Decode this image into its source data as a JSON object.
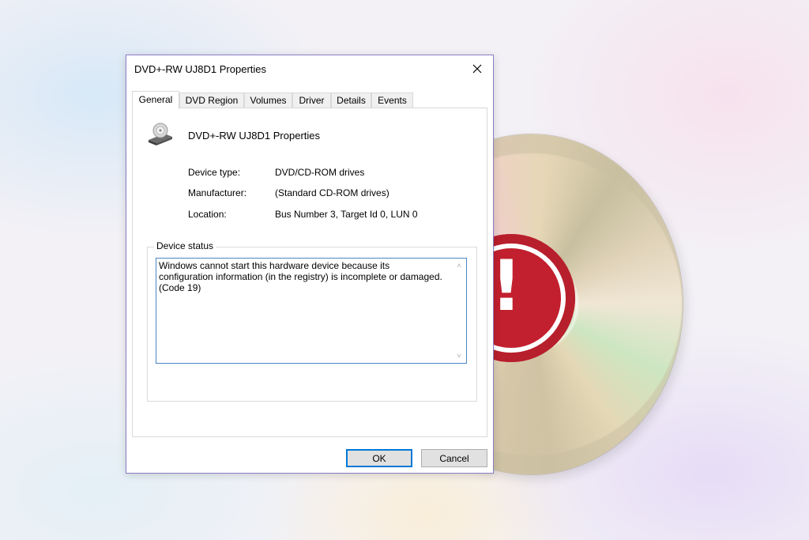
{
  "dialog": {
    "title": "DVD+-RW UJ8D1 Properties",
    "tabs": [
      {
        "label": "General"
      },
      {
        "label": "DVD Region"
      },
      {
        "label": "Volumes"
      },
      {
        "label": "Driver"
      },
      {
        "label": "Details"
      },
      {
        "label": "Events"
      }
    ],
    "device_name": "DVD+-RW UJ8D1 Properties",
    "properties": [
      {
        "label": "Device type:",
        "value": "DVD/CD-ROM drives"
      },
      {
        "label": "Manufacturer:",
        "value": "(Standard CD-ROM drives)"
      },
      {
        "label": "Location:",
        "value": "Bus Number 3, Target Id 0, LUN 0"
      }
    ],
    "status_group_label": "Device status",
    "status_lines": [
      "Windows cannot start this hardware device because its",
      "configuration information (in the registry) is incomplete or damaged.",
      "(Code 19)"
    ],
    "ok_label": "OK",
    "cancel_label": "Cancel"
  },
  "icons": {
    "close": "close-icon",
    "device": "dvd-drive-icon",
    "warning": "warning-icon"
  },
  "colors": {
    "accent": "#0078d7",
    "warning": "#c2202e",
    "window_border": "#8a7cc4"
  }
}
